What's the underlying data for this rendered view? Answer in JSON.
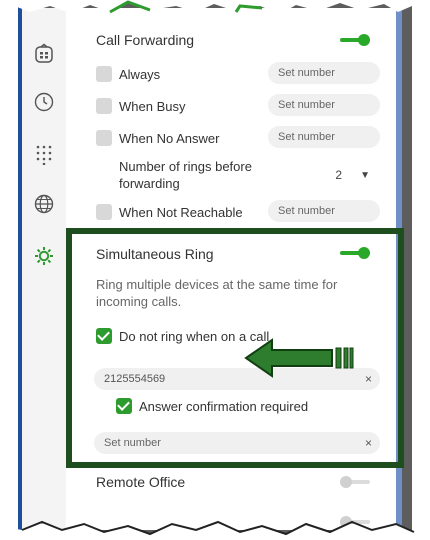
{
  "call_forwarding": {
    "title": "Call Forwarding",
    "options": [
      {
        "label": "Always",
        "placeholder": "Set number"
      },
      {
        "label": "When Busy",
        "placeholder": "Set number"
      },
      {
        "label": "When No Answer",
        "placeholder": "Set number"
      }
    ],
    "rings_label_line1": "Number of rings before",
    "rings_label_line2": "forwarding",
    "rings_value": "2",
    "not_reachable": {
      "label": "When Not Reachable",
      "placeholder": "Set number"
    }
  },
  "simultaneous_ring": {
    "title": "Simultaneous Ring",
    "description_line1": "Ring multiple devices at the same time for",
    "description_line2": "incoming calls.",
    "do_not_ring_label": "Do not ring when on a call",
    "number_value": "2125554569",
    "answer_confirmation_label": "Answer confirmation required",
    "new_number_placeholder": "Set number",
    "clear_glyph": "×"
  },
  "remote_office": {
    "title": "Remote Office"
  },
  "icons": {
    "sidebar": [
      "contacts-icon",
      "history-icon",
      "dialpad-icon",
      "globe-icon",
      "settings-icon"
    ],
    "active": "settings-icon"
  },
  "colors": {
    "accent_green": "#29a829",
    "highlight_border": "#1e4d1e",
    "arrow_green": "#2e7d2e"
  }
}
